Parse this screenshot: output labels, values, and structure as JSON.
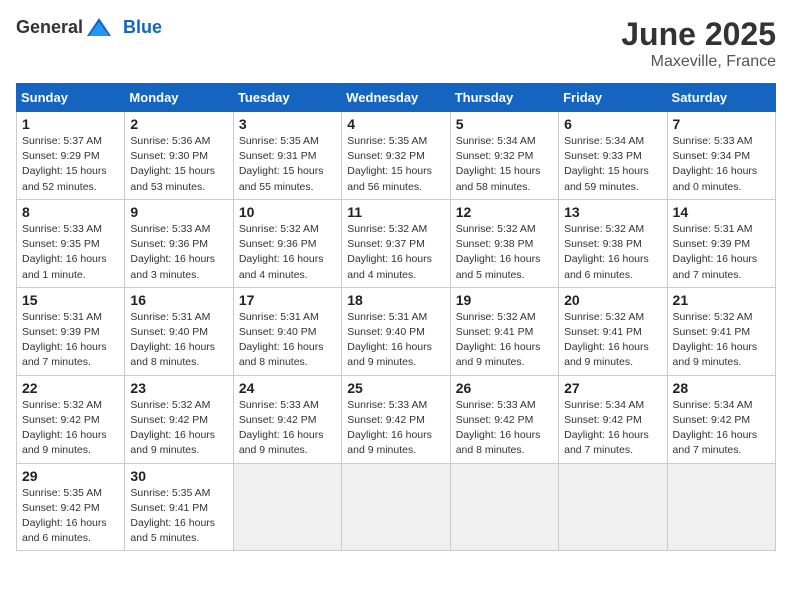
{
  "logo": {
    "general": "General",
    "blue": "Blue"
  },
  "title": "June 2025",
  "location": "Maxeville, France",
  "days_header": [
    "Sunday",
    "Monday",
    "Tuesday",
    "Wednesday",
    "Thursday",
    "Friday",
    "Saturday"
  ],
  "weeks": [
    [
      {
        "day": "1",
        "info": "Sunrise: 5:37 AM\nSunset: 9:29 PM\nDaylight: 15 hours\nand 52 minutes."
      },
      {
        "day": "2",
        "info": "Sunrise: 5:36 AM\nSunset: 9:30 PM\nDaylight: 15 hours\nand 53 minutes."
      },
      {
        "day": "3",
        "info": "Sunrise: 5:35 AM\nSunset: 9:31 PM\nDaylight: 15 hours\nand 55 minutes."
      },
      {
        "day": "4",
        "info": "Sunrise: 5:35 AM\nSunset: 9:32 PM\nDaylight: 15 hours\nand 56 minutes."
      },
      {
        "day": "5",
        "info": "Sunrise: 5:34 AM\nSunset: 9:32 PM\nDaylight: 15 hours\nand 58 minutes."
      },
      {
        "day": "6",
        "info": "Sunrise: 5:34 AM\nSunset: 9:33 PM\nDaylight: 15 hours\nand 59 minutes."
      },
      {
        "day": "7",
        "info": "Sunrise: 5:33 AM\nSunset: 9:34 PM\nDaylight: 16 hours\nand 0 minutes."
      }
    ],
    [
      {
        "day": "8",
        "info": "Sunrise: 5:33 AM\nSunset: 9:35 PM\nDaylight: 16 hours\nand 1 minute."
      },
      {
        "day": "9",
        "info": "Sunrise: 5:33 AM\nSunset: 9:36 PM\nDaylight: 16 hours\nand 3 minutes."
      },
      {
        "day": "10",
        "info": "Sunrise: 5:32 AM\nSunset: 9:36 PM\nDaylight: 16 hours\nand 4 minutes."
      },
      {
        "day": "11",
        "info": "Sunrise: 5:32 AM\nSunset: 9:37 PM\nDaylight: 16 hours\nand 4 minutes."
      },
      {
        "day": "12",
        "info": "Sunrise: 5:32 AM\nSunset: 9:38 PM\nDaylight: 16 hours\nand 5 minutes."
      },
      {
        "day": "13",
        "info": "Sunrise: 5:32 AM\nSunset: 9:38 PM\nDaylight: 16 hours\nand 6 minutes."
      },
      {
        "day": "14",
        "info": "Sunrise: 5:31 AM\nSunset: 9:39 PM\nDaylight: 16 hours\nand 7 minutes."
      }
    ],
    [
      {
        "day": "15",
        "info": "Sunrise: 5:31 AM\nSunset: 9:39 PM\nDaylight: 16 hours\nand 7 minutes."
      },
      {
        "day": "16",
        "info": "Sunrise: 5:31 AM\nSunset: 9:40 PM\nDaylight: 16 hours\nand 8 minutes."
      },
      {
        "day": "17",
        "info": "Sunrise: 5:31 AM\nSunset: 9:40 PM\nDaylight: 16 hours\nand 8 minutes."
      },
      {
        "day": "18",
        "info": "Sunrise: 5:31 AM\nSunset: 9:40 PM\nDaylight: 16 hours\nand 9 minutes."
      },
      {
        "day": "19",
        "info": "Sunrise: 5:32 AM\nSunset: 9:41 PM\nDaylight: 16 hours\nand 9 minutes."
      },
      {
        "day": "20",
        "info": "Sunrise: 5:32 AM\nSunset: 9:41 PM\nDaylight: 16 hours\nand 9 minutes."
      },
      {
        "day": "21",
        "info": "Sunrise: 5:32 AM\nSunset: 9:41 PM\nDaylight: 16 hours\nand 9 minutes."
      }
    ],
    [
      {
        "day": "22",
        "info": "Sunrise: 5:32 AM\nSunset: 9:42 PM\nDaylight: 16 hours\nand 9 minutes."
      },
      {
        "day": "23",
        "info": "Sunrise: 5:32 AM\nSunset: 9:42 PM\nDaylight: 16 hours\nand 9 minutes."
      },
      {
        "day": "24",
        "info": "Sunrise: 5:33 AM\nSunset: 9:42 PM\nDaylight: 16 hours\nand 9 minutes."
      },
      {
        "day": "25",
        "info": "Sunrise: 5:33 AM\nSunset: 9:42 PM\nDaylight: 16 hours\nand 9 minutes."
      },
      {
        "day": "26",
        "info": "Sunrise: 5:33 AM\nSunset: 9:42 PM\nDaylight: 16 hours\nand 8 minutes."
      },
      {
        "day": "27",
        "info": "Sunrise: 5:34 AM\nSunset: 9:42 PM\nDaylight: 16 hours\nand 7 minutes."
      },
      {
        "day": "28",
        "info": "Sunrise: 5:34 AM\nSunset: 9:42 PM\nDaylight: 16 hours\nand 7 minutes."
      }
    ],
    [
      {
        "day": "29",
        "info": "Sunrise: 5:35 AM\nSunset: 9:42 PM\nDaylight: 16 hours\nand 6 minutes."
      },
      {
        "day": "30",
        "info": "Sunrise: 5:35 AM\nSunset: 9:41 PM\nDaylight: 16 hours\nand 5 minutes."
      },
      null,
      null,
      null,
      null,
      null
    ]
  ]
}
